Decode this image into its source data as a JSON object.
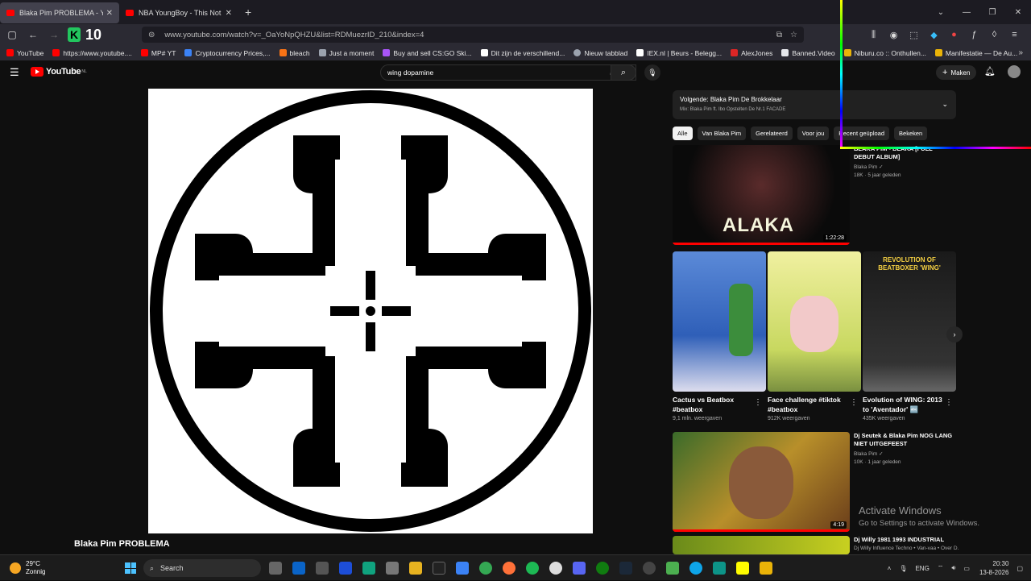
{
  "tabs": [
    {
      "title": "Blaka Pim PROBLEMA - YouTube",
      "active": true
    },
    {
      "title": "NBA YoungBoy - This Not a Song",
      "active": false
    }
  ],
  "kbadge": {
    "letter": "K",
    "number": "10"
  },
  "url": "www.youtube.com/watch?v=_OaYoNpQHZU&list=RDMuezrID_210&index=4",
  "bookmarks": [
    {
      "label": "YouTube",
      "color": "#ff0000"
    },
    {
      "label": "https://www.youtube....",
      "color": "#ff0000"
    },
    {
      "label": "MP# YT",
      "color": "#ff0000"
    },
    {
      "label": "Cryptocurrency Prices,...",
      "color": "#3b82f6"
    },
    {
      "label": "bleach",
      "color": "#f97316"
    },
    {
      "label": "Just a moment",
      "color": "#9ca3af"
    },
    {
      "label": "Buy and sell CS:GO Ski...",
      "color": "#a855f7"
    },
    {
      "label": "Dit zijn de verschillend...",
      "color": "#ffffff"
    },
    {
      "label": "Nieuw tabblad",
      "color": "#9ca3af"
    },
    {
      "label": "IEX.nl | Beurs - Belegg...",
      "color": "#ffffff"
    },
    {
      "label": "AlexJones",
      "color": "#dc2626"
    },
    {
      "label": "Banned.Video",
      "color": "#e5e7eb"
    },
    {
      "label": "Niburu.co :: Onthullen...",
      "color": "#eab308"
    },
    {
      "label": "Manifestatie — De Au...",
      "color": "#eab308"
    }
  ],
  "youtube": {
    "logo": "YouTube",
    "region": "NL",
    "search_value": "wing dopamine",
    "create_label": "Maken"
  },
  "video": {
    "title": "Blaka Pim PROBLEMA"
  },
  "queue": {
    "next": "Volgende: Blaka Pim De Brokkelaar",
    "mix": "Mix: Blaka Pim ft. Ibo Opstelten De Nr.1 FACADE"
  },
  "chips": [
    "Alle",
    "Van Blaka Pim",
    "Gerelateerd",
    "Voor jou",
    "Recent geüpload",
    "Bekeken"
  ],
  "recs": [
    {
      "title": "BLAKA PIM - BLAKA [FULL DEBUT ALBUM]",
      "channel": "Blaka Pim ✓",
      "stats": "18K · 5 jaar geleden",
      "duration": "1:22:28",
      "thumb_text": "ALAKA"
    },
    {
      "title": "Dj Seutek & Blaka Pim NOG LANG NIET UITGEFEEST",
      "channel": "Blaka Pim ✓",
      "stats": "10K · 1 jaar geleden",
      "duration": "4:19"
    },
    {
      "title": "Dj Willy 1981 1993 INDUSTRIAL",
      "channel": "Dj Willy Influence Techno • Van-vaa • Over D..."
    }
  ],
  "shorts": [
    {
      "title": "Cactus vs Beatbox #beatbox",
      "views": "9,1 mln. weergaven"
    },
    {
      "title": "Face challenge #tiktok #beatbox",
      "views": "912K weergaven"
    },
    {
      "title": "Evolution of WING: 2013 to 'Aventador' 🔤",
      "views": "435K weergaven",
      "overlay": "REVOLUTION OF BEATBOXER 'WING'"
    }
  ],
  "activate": {
    "line1": "Activate Windows",
    "line2": "Go to Settings to activate Windows."
  },
  "taskbar": {
    "temp": "29°C",
    "weather": "Zonnig",
    "search": "Search",
    "lang": "ENG",
    "time": "20:30",
    "date": "13-8-2026"
  }
}
